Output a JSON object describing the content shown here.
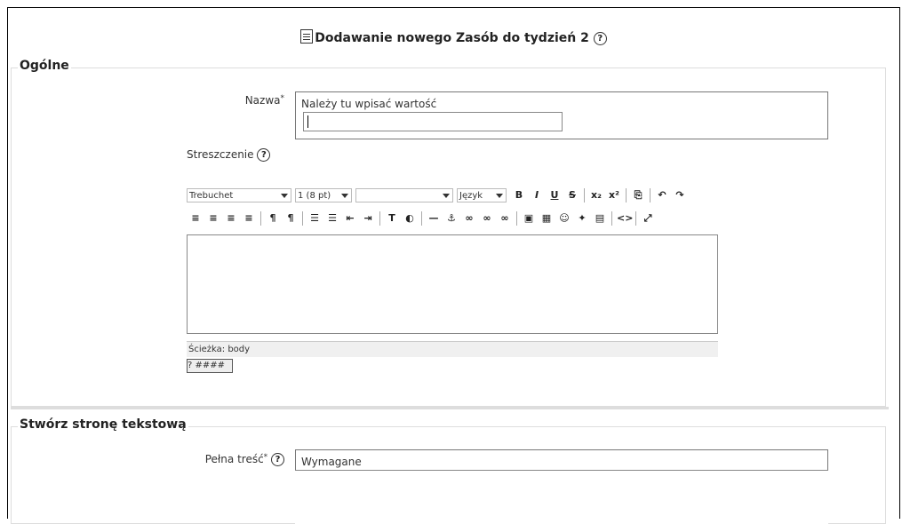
{
  "header": {
    "title": "Dodawanie nowego Zasób do tydzień 2"
  },
  "general": {
    "legend": "Ogólne",
    "name_label": "Nazwa",
    "name_required_mark": "*",
    "name_hint": "Należy tu wpisać wartość",
    "name_value": "",
    "summary_label": "Streszczenie"
  },
  "editor": {
    "font_family": "Trebuchet",
    "font_size": "1 (8 pt)",
    "style": "",
    "language": "Język",
    "toolbar_row1": [
      "B",
      "I",
      "U",
      "S",
      "x₂",
      "x²",
      "⎘",
      "↶",
      "↷"
    ],
    "toolbar_row2": [
      "≡",
      "≡",
      "≡",
      "≡",
      "¶",
      "¶",
      "☰",
      "☰",
      "⇤",
      "⇥",
      "T",
      "◐",
      "—",
      "⚓",
      "∞",
      "∞",
      "∞",
      "▣",
      "▦",
      "☺",
      "✦",
      "▤",
      "<>",
      "⤢"
    ],
    "path_label": "Ścieżka:",
    "path_value": "body",
    "kbd_label": "? ####"
  },
  "text_page": {
    "legend": "Stwórz stronę tekstową",
    "full_label": "Pełna treść",
    "full_required_mark": "*",
    "full_hint": "Wymagane"
  }
}
